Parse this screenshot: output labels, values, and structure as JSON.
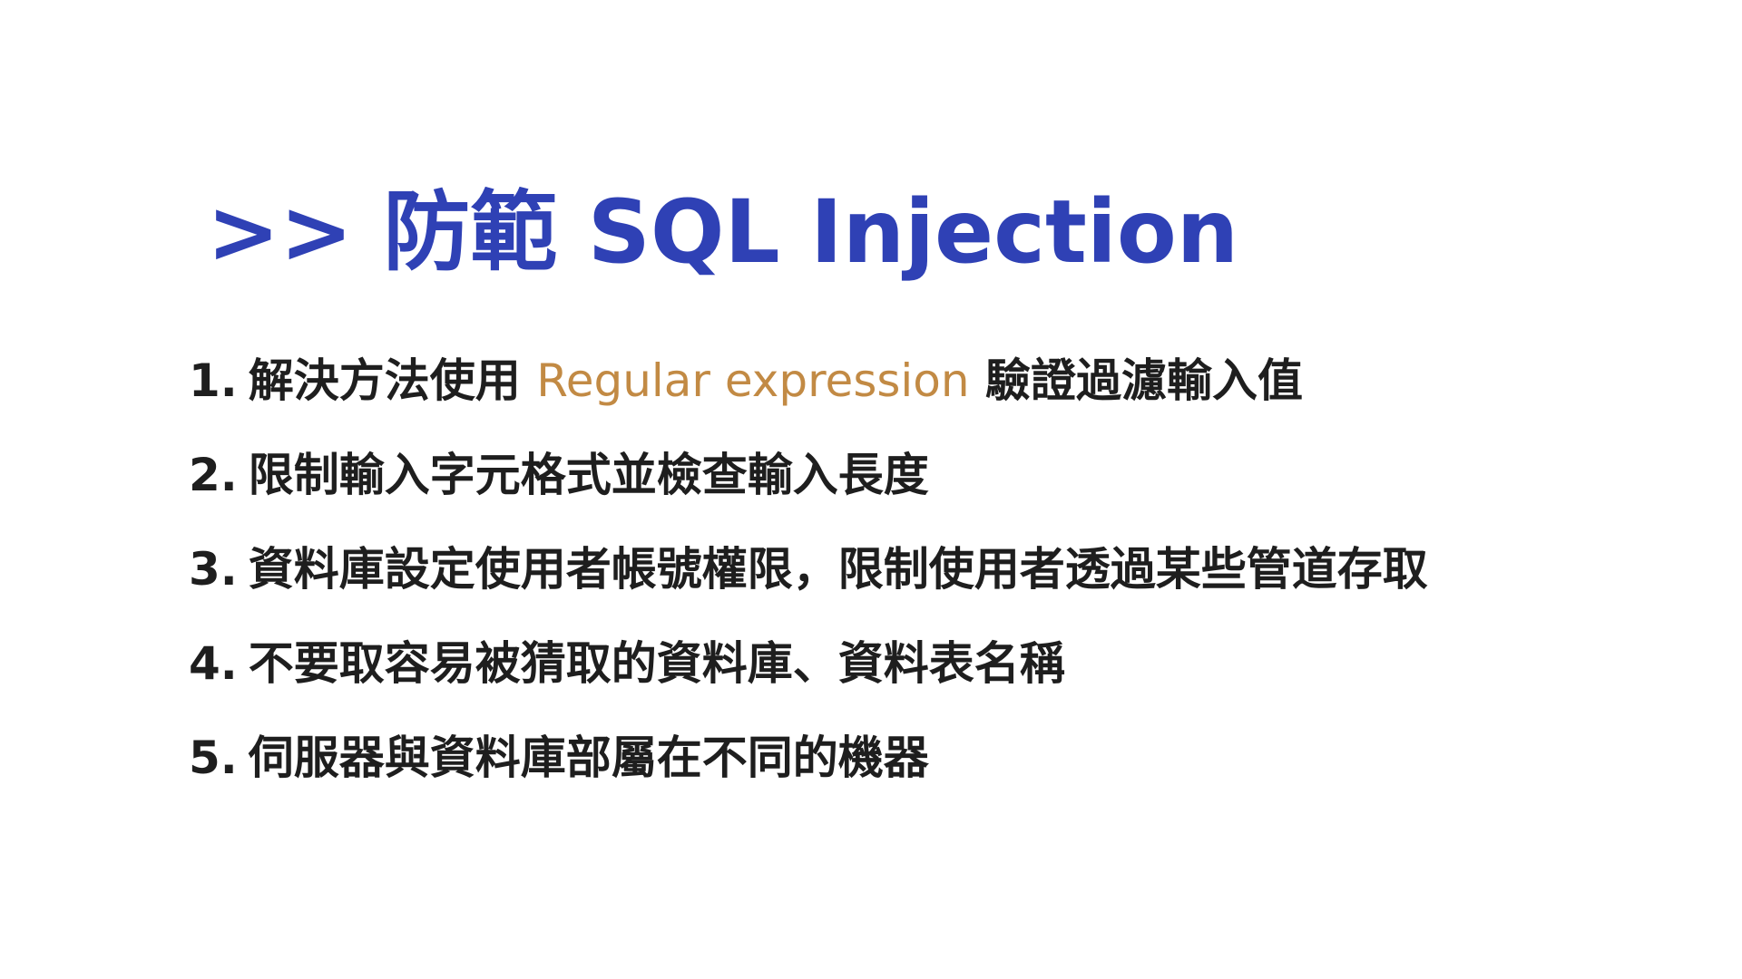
{
  "title": ">> 防範 SQL Injection",
  "items": [
    {
      "number": "1.",
      "text_before": "解決方法使用",
      "highlight": "Regular expression",
      "text_after": "驗證過濾輸入值"
    },
    {
      "number": "2.",
      "text": "限制輸入字元格式並檢查輸入長度"
    },
    {
      "number": "3.",
      "text": "資料庫設定使用者帳號權限，限制使用者透過某些管道存取"
    },
    {
      "number": "4.",
      "text": "不要取容易被猜取的資料庫、資料表名稱"
    },
    {
      "number": "5.",
      "text": "伺服器與資料庫部屬在不同的機器"
    }
  ],
  "colors": {
    "title": "#2f41b5",
    "highlight": "#c28a44",
    "body_text": "#1e1e1e",
    "background": "#ffffff"
  }
}
